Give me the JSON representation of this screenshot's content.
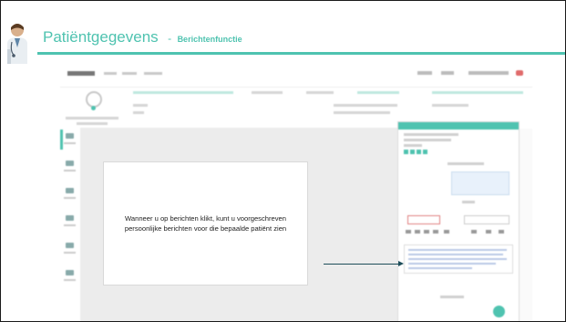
{
  "slide": {
    "title": "Patiëntgegevens",
    "separator": "-",
    "subtitle": "Berichtenfunctie",
    "icon": "doctor-icon"
  },
  "callout": {
    "text": "Wanneer u op berichten klikt, kunt u voorgeschreven persoonlijke berichten voor die bepaalde patiënt zien"
  },
  "colors": {
    "accent": "#4fc3b0",
    "arrow": "#1e4e5a",
    "panel_header": "#4fc3b0"
  }
}
